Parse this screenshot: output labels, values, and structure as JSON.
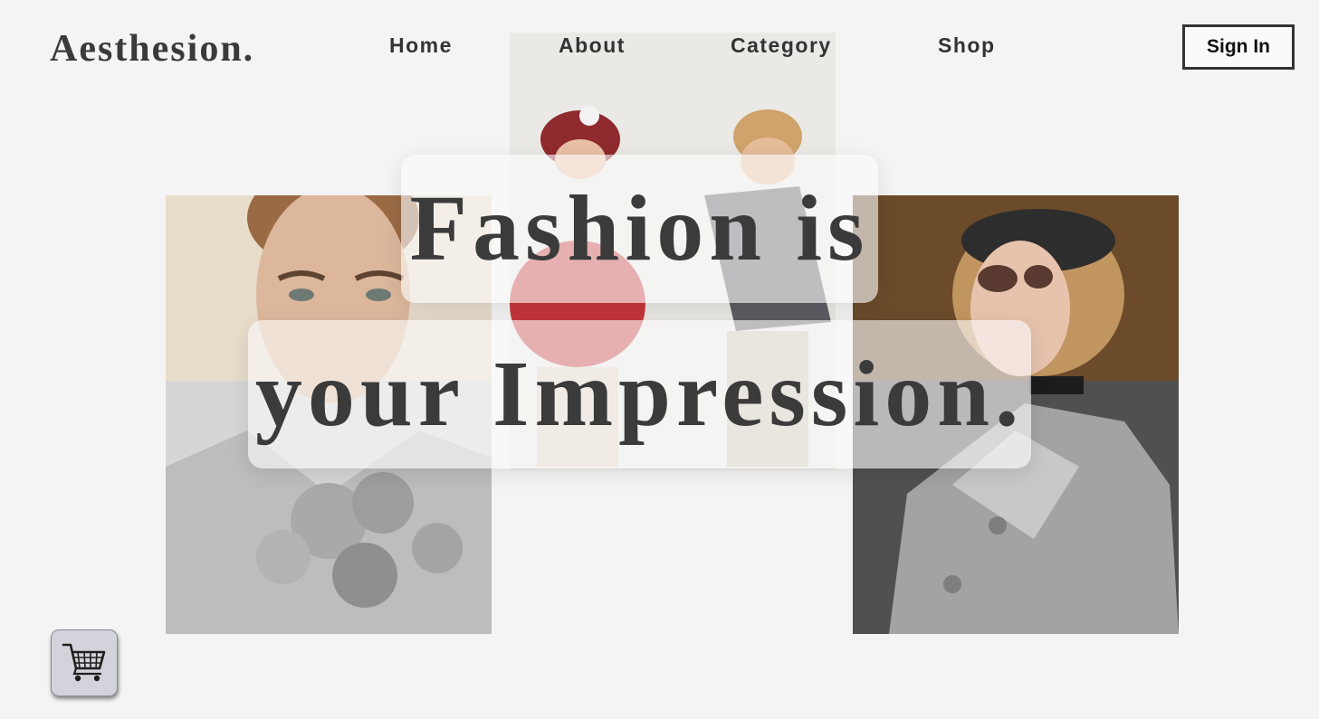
{
  "brand": {
    "logo_text": "Aesthesion."
  },
  "nav": {
    "items": [
      {
        "label": "Home"
      },
      {
        "label": "About"
      },
      {
        "label": "Category"
      },
      {
        "label": "Shop"
      }
    ],
    "signin_label": "Sign In"
  },
  "hero": {
    "line1": "Fashion is",
    "line2": "your Impression."
  },
  "cart": {
    "icon": "shopping-cart-icon"
  },
  "colors": {
    "background": "#f4f4f4",
    "text": "#3b3b3b",
    "cart_button": "#d3d4db"
  }
}
